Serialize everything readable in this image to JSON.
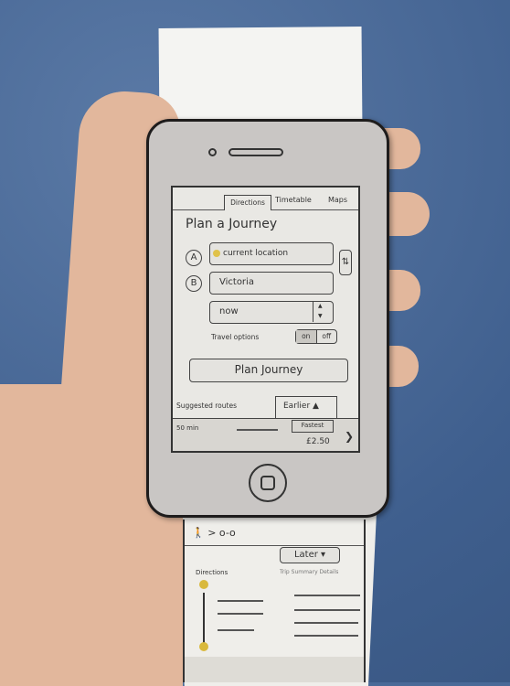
{
  "tabs": {
    "directions": "Directions",
    "timetable": "Timetable",
    "maps": "Maps"
  },
  "title": "Plan a Journey",
  "from": {
    "marker": "A",
    "value": "current location"
  },
  "to": {
    "marker": "B",
    "value": "Victoria"
  },
  "time": {
    "value": "now",
    "up": "▲",
    "down": "▼"
  },
  "swap": "⇅",
  "travel_options": {
    "label": "Travel options",
    "on": "on",
    "off": "off"
  },
  "plan_button": "Plan Journey",
  "suggested": {
    "label": "Suggested routes",
    "earlier": "Earlier ▲"
  },
  "route": {
    "duration": "50 min",
    "tag": "Fastest",
    "price": "£2.50",
    "more": "❯"
  },
  "strip": {
    "route_icons": "🚶 > o-o",
    "later": "Later ▾",
    "directions": "Directions",
    "options": "Trip  Summary  Details"
  },
  "colors": {
    "carpet": "#4a6a98",
    "paper": "#e9e8e4",
    "phone": "#c9c6c4",
    "skin": "#e2b79c"
  }
}
